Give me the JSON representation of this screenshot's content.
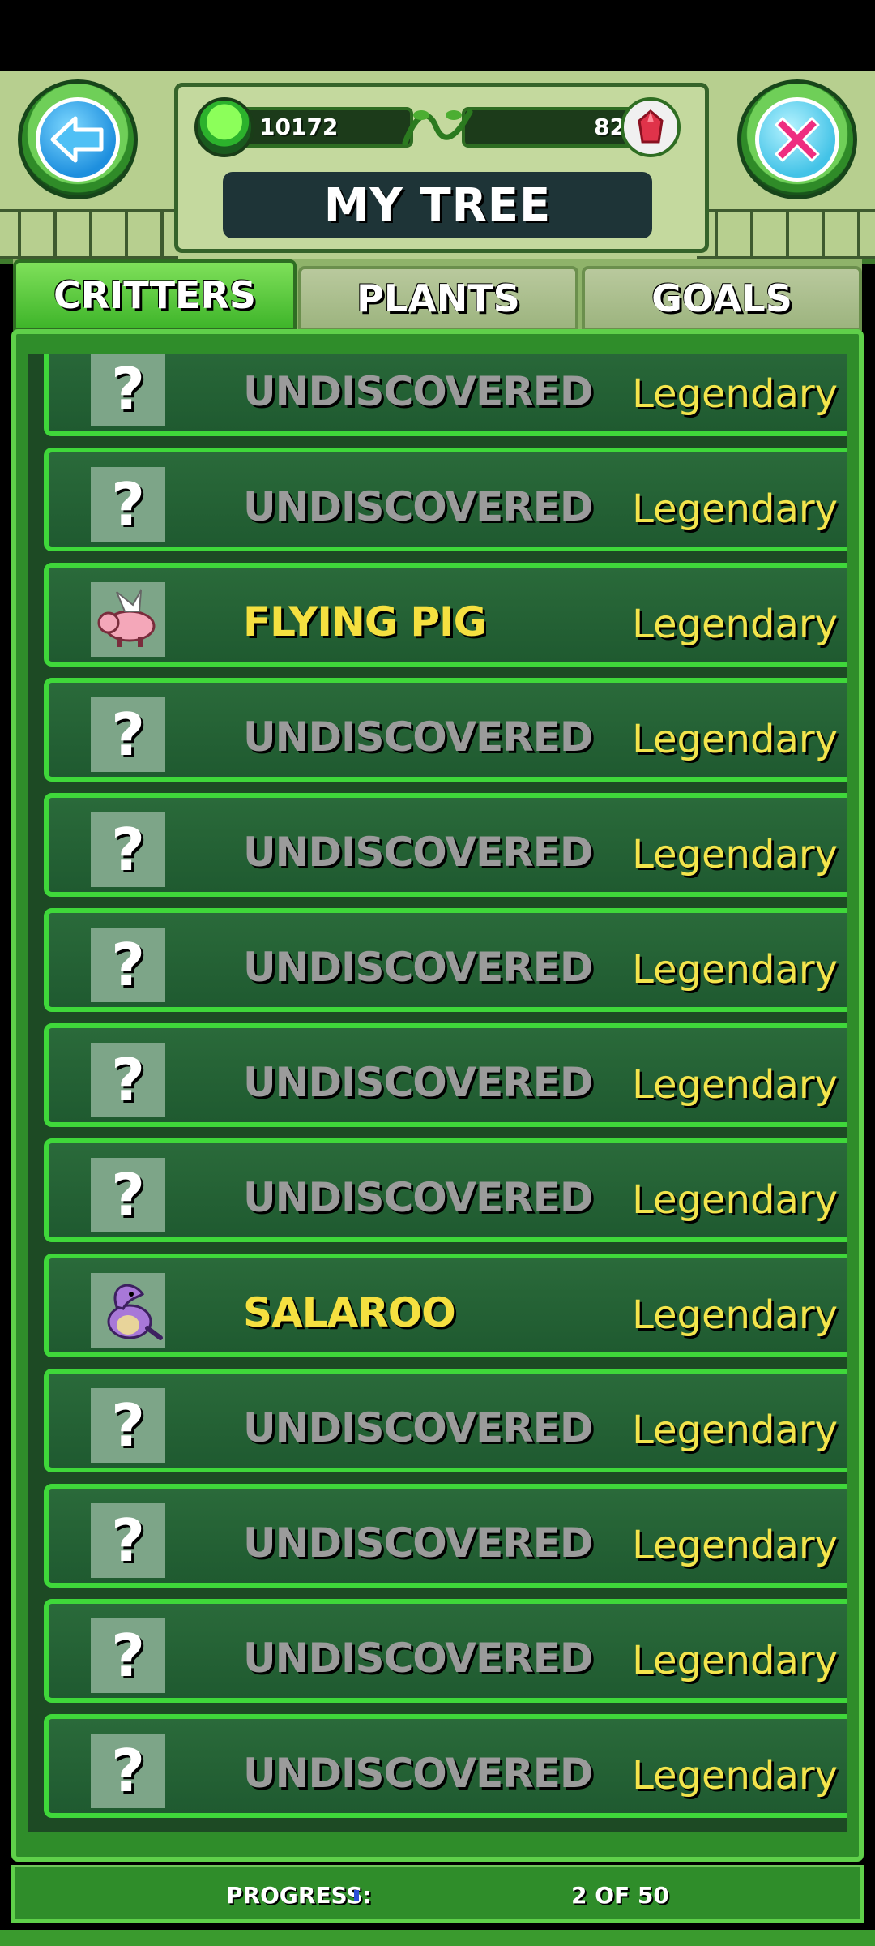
{
  "header": {
    "title": "MY TREE",
    "coins": "10172",
    "gems": "82"
  },
  "tabs": [
    {
      "label": "CRITTERS",
      "active": true
    },
    {
      "label": "PLANTS",
      "active": false
    },
    {
      "label": "GOALS",
      "active": false
    }
  ],
  "critters": [
    {
      "name": "UNDISCOVERED",
      "rarity": "Legendary",
      "discovered": false,
      "icon": "question-mark-icon"
    },
    {
      "name": "UNDISCOVERED",
      "rarity": "Legendary",
      "discovered": false,
      "icon": "question-mark-icon"
    },
    {
      "name": "FLYING PIG",
      "rarity": "Legendary",
      "discovered": true,
      "icon": "flying-pig-icon"
    },
    {
      "name": "UNDISCOVERED",
      "rarity": "Legendary",
      "discovered": false,
      "icon": "question-mark-icon"
    },
    {
      "name": "UNDISCOVERED",
      "rarity": "Legendary",
      "discovered": false,
      "icon": "question-mark-icon"
    },
    {
      "name": "UNDISCOVERED",
      "rarity": "Legendary",
      "discovered": false,
      "icon": "question-mark-icon"
    },
    {
      "name": "UNDISCOVERED",
      "rarity": "Legendary",
      "discovered": false,
      "icon": "question-mark-icon"
    },
    {
      "name": "UNDISCOVERED",
      "rarity": "Legendary",
      "discovered": false,
      "icon": "question-mark-icon"
    },
    {
      "name": "SALAROO",
      "rarity": "Legendary",
      "discovered": true,
      "icon": "salaroo-icon"
    },
    {
      "name": "UNDISCOVERED",
      "rarity": "Legendary",
      "discovered": false,
      "icon": "question-mark-icon"
    },
    {
      "name": "UNDISCOVERED",
      "rarity": "Legendary",
      "discovered": false,
      "icon": "question-mark-icon"
    },
    {
      "name": "UNDISCOVERED",
      "rarity": "Legendary",
      "discovered": false,
      "icon": "question-mark-icon"
    },
    {
      "name": "UNDISCOVERED",
      "rarity": "Legendary",
      "discovered": false,
      "icon": "question-mark-icon"
    }
  ],
  "footer": {
    "progress_label": "PROGRESS:",
    "progress_fraction": 0.04,
    "progress_count": "2 OF 50"
  },
  "colors": {
    "rarity": "#f3e44c",
    "discovered_name": "#f5e040",
    "undiscovered_name": "#9b9b9b",
    "row_border": "#3fd83a"
  }
}
